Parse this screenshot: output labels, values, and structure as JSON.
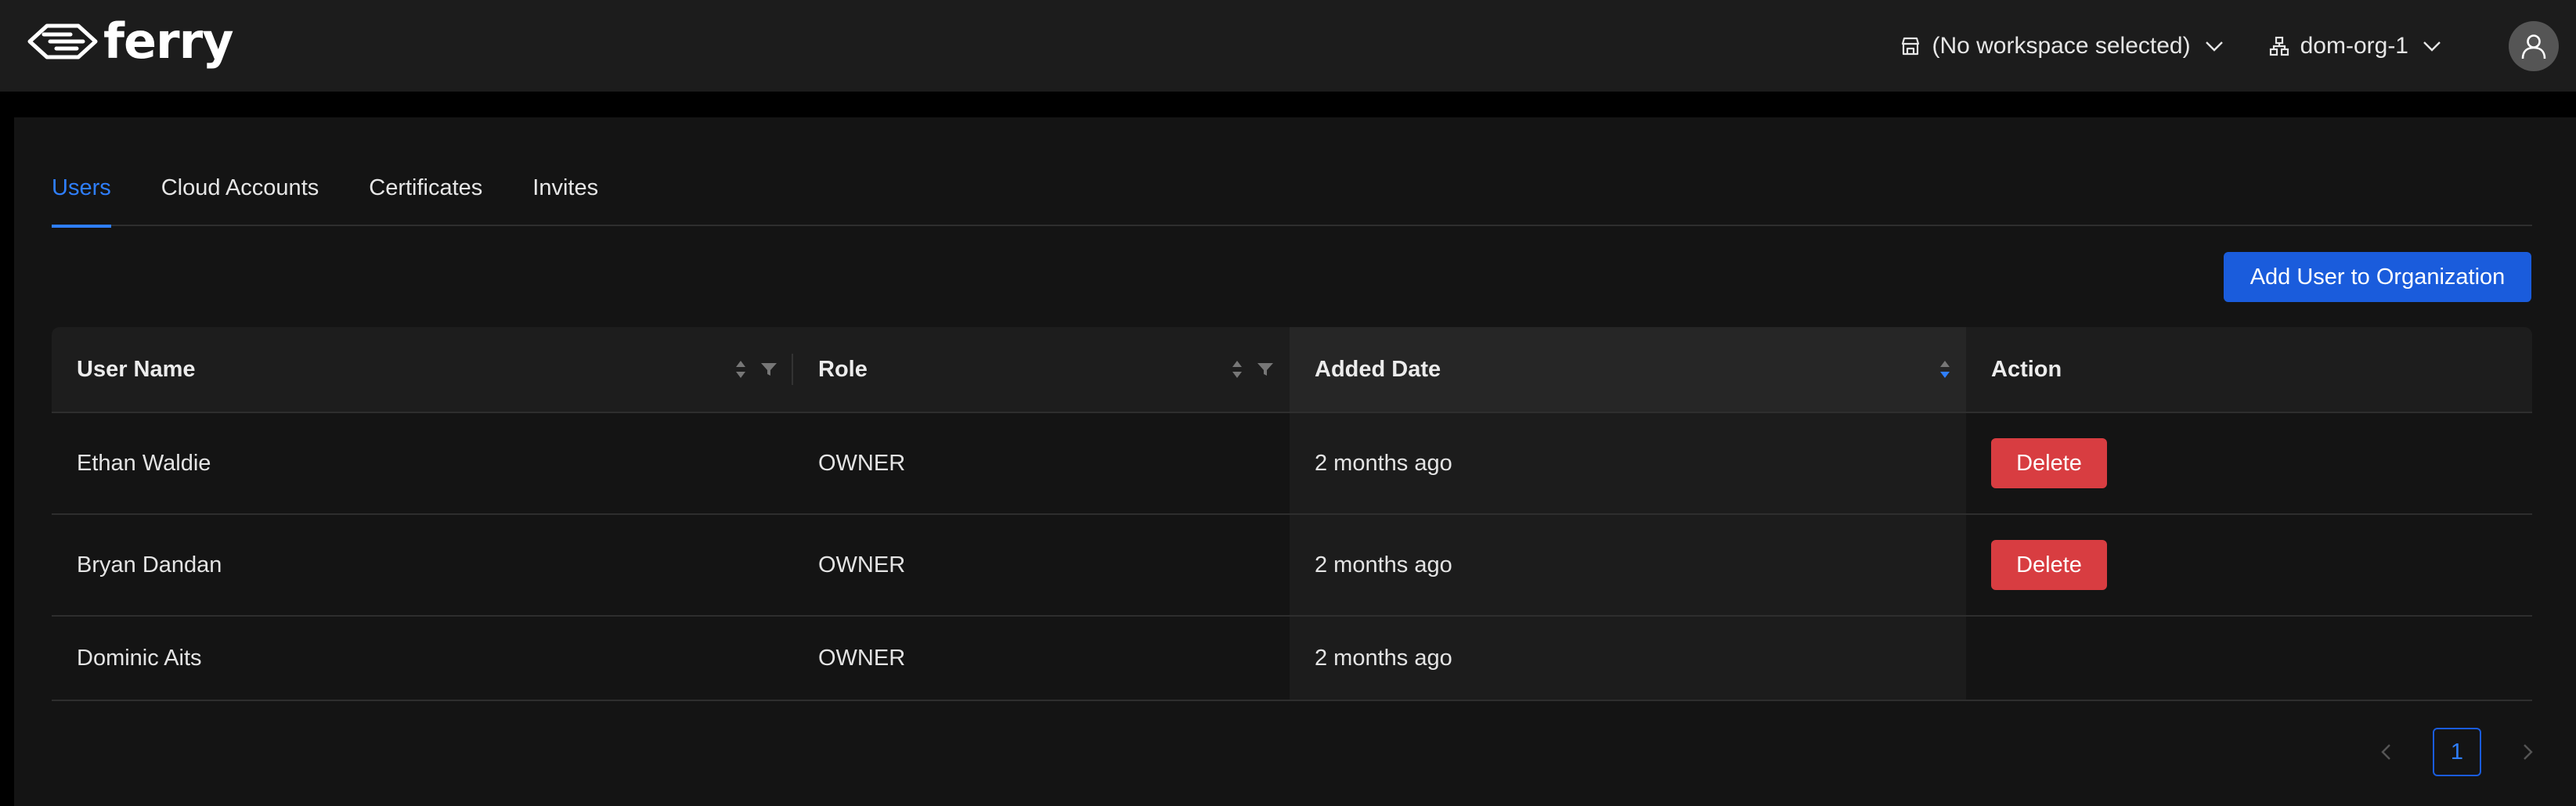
{
  "header": {
    "logo_text": "ferry",
    "workspace_label": "(No workspace selected)",
    "org_label": "dom-org-1"
  },
  "tabs": [
    {
      "label": "Users",
      "active": true
    },
    {
      "label": "Cloud Accounts",
      "active": false
    },
    {
      "label": "Certificates",
      "active": false
    },
    {
      "label": "Invites",
      "active": false
    }
  ],
  "toolbar": {
    "add_user_label": "Add User to Organization"
  },
  "table": {
    "columns": [
      "User Name",
      "Role",
      "Added Date",
      "Action"
    ],
    "sorted_column": "Added Date",
    "rows": [
      {
        "name": "Ethan Waldie",
        "role": "OWNER",
        "added": "2 months ago",
        "action": "Delete"
      },
      {
        "name": "Bryan Dandan",
        "role": "OWNER",
        "added": "2 months ago",
        "action": "Delete"
      },
      {
        "name": "Dominic Aits",
        "role": "OWNER",
        "added": "2 months ago",
        "action": ""
      }
    ]
  },
  "pagination": {
    "current_page": "1"
  },
  "colors": {
    "accent": "#2f7fff",
    "primary_button": "#1a5cdc",
    "danger": "#d83d41",
    "background": "#141414",
    "topbar": "#1c1c1c"
  }
}
